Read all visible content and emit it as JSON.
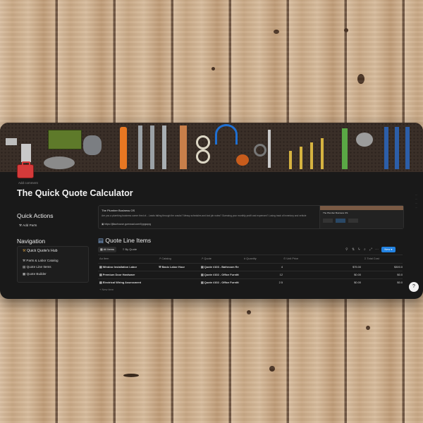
{
  "page": {
    "add_comment": "Add comment",
    "title": "The Quick Quote Calculator"
  },
  "quick_actions": {
    "heading": "Quick Actions",
    "items": [
      {
        "label": "Add Parts",
        "icon": "hammer-icon"
      }
    ]
  },
  "navigation": {
    "heading": "Navigation",
    "hub_label": "Quick Quote's Hub",
    "items": [
      {
        "label": "Parts & Labor Catalog",
        "icon": "hammer-icon"
      },
      {
        "label": "Quote Line Items",
        "icon": "page-icon"
      },
      {
        "label": "Quote Builder",
        "icon": "calculator-icon"
      }
    ]
  },
  "promo": {
    "title": "The Plumber Business OS",
    "description": "Are you a plumbing business owner tired of... Leads falling through the cracks? Messy schedules and lost job notes? Guessing your monthly profit and expenses? Losing track of inventory and vehicle",
    "link": "https://jflaurhouse.gumroad.com/l/ypgcqxg",
    "thumb_title": "The Plumber Business OS"
  },
  "database": {
    "title": "Quote Line Items",
    "tabs": [
      {
        "label": "All Items"
      },
      {
        "label": "By Quote"
      }
    ],
    "new_label": "New",
    "columns": [
      "Item",
      "Catalog",
      "Quote",
      "Quantity",
      "Unit Price",
      "Total Cost"
    ],
    "rows": [
      {
        "item": "Window Installation Labor",
        "catalog": "Basic Labor Hour",
        "quote": "Quote #103 - Bathroom Re",
        "quantity": "4",
        "unit_price": "$75.00",
        "total": "$300.0"
      },
      {
        "item": "Premium Door Hardware",
        "catalog": "",
        "quote": "Quote #102 - Office Furnitt",
        "quantity": "12",
        "unit_price": "$0.00",
        "total": "$0.0"
      },
      {
        "item": "Electrical Wiring Assessment",
        "catalog": "",
        "quote": "Quote #102 - Office Furnitt",
        "quantity": "2.5",
        "unit_price": "$0.00",
        "total": "$0.0"
      }
    ],
    "new_item_label": "+ New item"
  },
  "help_label": "?"
}
